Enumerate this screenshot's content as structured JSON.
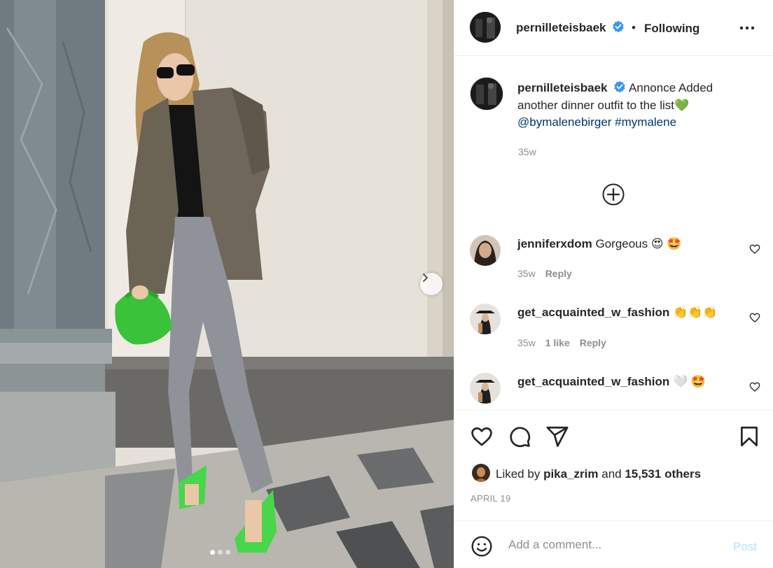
{
  "post": {
    "author": "pernilleteisbaek",
    "follow_separator": "•",
    "follow_status": "Following",
    "caption": {
      "username": "pernilleteisbaek",
      "text": "Annonce Added another dinner outfit to the list",
      "emoji": "💚",
      "mention": "@bymalenebirger",
      "hashtag": "#mymalene",
      "time": "35w"
    },
    "carousel": {
      "slides": 3,
      "active_index": 0
    }
  },
  "comments": [
    {
      "username": "jenniferxdom",
      "text": "Gorgeous",
      "emojis": "😍 🤩",
      "time": "35w",
      "likes": "",
      "reply_label": "Reply"
    },
    {
      "username": "get_acquainted_w_fashion",
      "text": "",
      "emojis": "👏👏👏",
      "time": "35w",
      "likes": "1 like",
      "reply_label": "Reply"
    },
    {
      "username": "get_acquainted_w_fashion",
      "text": "",
      "emojis": "🤍 🤩",
      "time": "",
      "likes": "",
      "reply_label": ""
    }
  ],
  "likes": {
    "prefix": "Liked by",
    "user": "pika_zrim",
    "conj": "and",
    "others": "15,531 others"
  },
  "date": "APRIL 19",
  "composer": {
    "placeholder": "Add a comment...",
    "post_label": "Post"
  },
  "colors": {
    "verified": "#3897f0",
    "link": "#00376b",
    "muted": "#8e8e8e",
    "post_disabled": "#b2dffc"
  },
  "icons": [
    "verified-badge-icon",
    "more-icon",
    "add-circle-icon",
    "heart-icon",
    "comment-icon",
    "share-icon",
    "save-icon",
    "emoji-icon",
    "chevron-right-icon"
  ]
}
